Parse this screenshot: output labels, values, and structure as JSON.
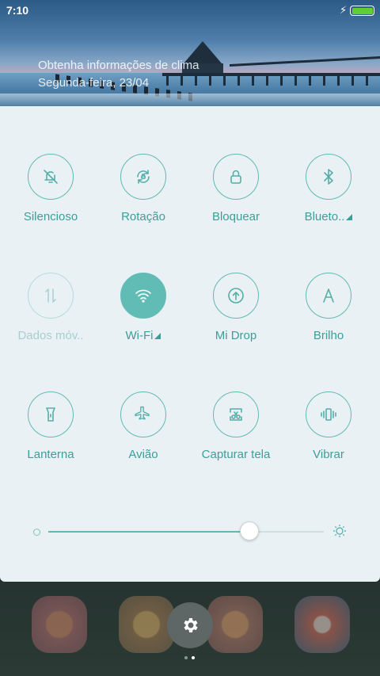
{
  "status_bar": {
    "time": "7:10",
    "battery_color": "#5fd034",
    "charging": true
  },
  "header": {
    "weather_line1": "Obtenha informações de clima",
    "weather_line2": "Segunda-feira, 23/04"
  },
  "accent_color": "#61bcb5",
  "tiles": [
    {
      "label": "Silencioso",
      "icon": "bell-off-icon",
      "state": "normal",
      "has_arrow": false
    },
    {
      "label": "Rotação",
      "icon": "rotation-lock-icon",
      "state": "normal",
      "has_arrow": false
    },
    {
      "label": "Bloquear",
      "icon": "lock-icon",
      "state": "normal",
      "has_arrow": false
    },
    {
      "label": "Blueto..",
      "icon": "bluetooth-icon",
      "state": "normal",
      "has_arrow": true
    },
    {
      "label": "Dados móv..",
      "icon": "mobile-data-icon",
      "state": "disabled",
      "has_arrow": false
    },
    {
      "label": "Wi-Fi",
      "icon": "wifi-icon",
      "state": "active",
      "has_arrow": true
    },
    {
      "label": "Mi Drop",
      "icon": "mi-drop-icon",
      "state": "normal",
      "has_arrow": false
    },
    {
      "label": "Brilho",
      "icon": "auto-brightness-icon",
      "state": "normal",
      "has_arrow": false
    },
    {
      "label": "Lanterna",
      "icon": "flashlight-icon",
      "state": "normal",
      "has_arrow": false
    },
    {
      "label": "Avião",
      "icon": "airplane-icon",
      "state": "normal",
      "has_arrow": false
    },
    {
      "label": "Capturar tela",
      "icon": "screenshot-icon",
      "state": "normal",
      "has_arrow": false
    },
    {
      "label": "Vibrar",
      "icon": "vibrate-icon",
      "state": "normal",
      "has_arrow": false
    }
  ],
  "brightness": {
    "level": 0.73
  },
  "home_screen": {
    "page_indicator": {
      "count": 2,
      "active_index": 1
    }
  }
}
